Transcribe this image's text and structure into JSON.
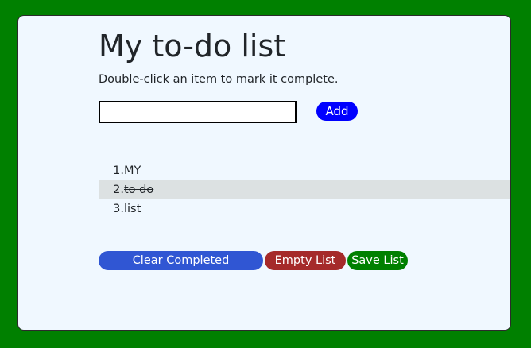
{
  "page": {
    "title": "My to-do list",
    "instructions": "Double-click an item to mark it complete."
  },
  "input": {
    "value": "",
    "placeholder": ""
  },
  "buttons": {
    "add": "Add",
    "clear_completed": "Clear Completed",
    "empty_list": "Empty List",
    "save_list": "Save List"
  },
  "todos": [
    {
      "number": "1.",
      "text": "MY",
      "completed": false
    },
    {
      "number": "2.",
      "text": "to do",
      "completed": true
    },
    {
      "number": "3.",
      "text": "list",
      "completed": false
    }
  ],
  "colors": {
    "page_background": "#008000",
    "card_background": "#f0f8ff",
    "add_button": "#0000ff",
    "clear_button": "#3056d3",
    "empty_button": "#a52a2a",
    "save_button": "#008000",
    "completed_row": "#dce1e2"
  }
}
